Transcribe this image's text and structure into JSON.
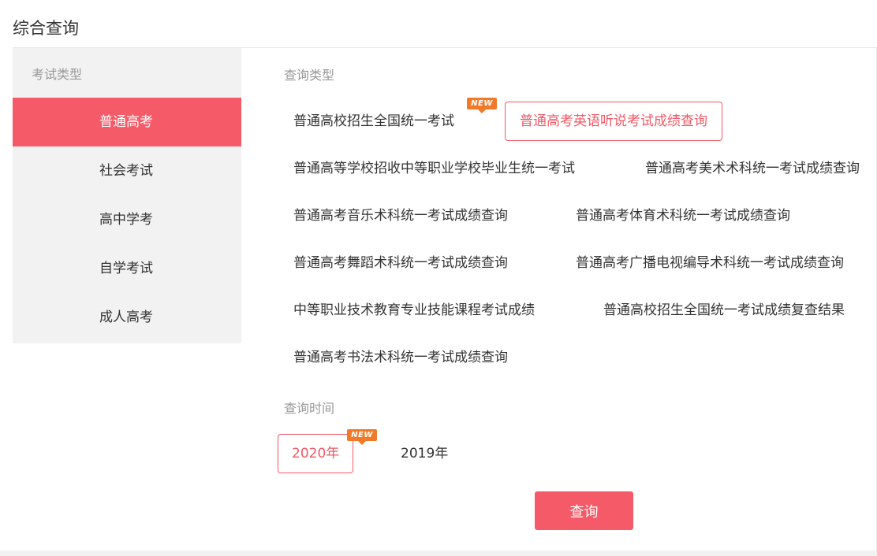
{
  "page": {
    "title": "综合查询"
  },
  "sidebar": {
    "heading": "考试类型",
    "items": [
      {
        "label": "普通高考",
        "active": true
      },
      {
        "label": "社会考试",
        "active": false
      },
      {
        "label": "高中学考",
        "active": false
      },
      {
        "label": "自学考试",
        "active": false
      },
      {
        "label": "成人高考",
        "active": false
      }
    ]
  },
  "query_type": {
    "label": "查询类型",
    "options": [
      {
        "label": "普通高校招生全国统一考试",
        "is_new": true,
        "selected": false
      },
      {
        "label": "普通高考英语听说考试成绩查询",
        "is_new": false,
        "selected": true
      },
      {
        "label": "普通高等学校招收中等职业学校毕业生统一考试",
        "is_new": false,
        "selected": false
      },
      {
        "label": "普通高考美术术科统一考试成绩查询",
        "is_new": false,
        "selected": false
      },
      {
        "label": "普通高考音乐术科统一考试成绩查询",
        "is_new": false,
        "selected": false
      },
      {
        "label": "普通高考体育术科统一考试成绩查询",
        "is_new": false,
        "selected": false
      },
      {
        "label": "普通高考舞蹈术科统一考试成绩查询",
        "is_new": false,
        "selected": false
      },
      {
        "label": "普通高考广播电视编导术科统一考试成绩查询",
        "is_new": false,
        "selected": false
      },
      {
        "label": "中等职业技术教育专业技能课程考试成绩",
        "is_new": false,
        "selected": false
      },
      {
        "label": "普通高校招生全国统一考试成绩复查结果",
        "is_new": false,
        "selected": false
      },
      {
        "label": "普通高考书法术科统一考试成绩查询",
        "is_new": false,
        "selected": false
      }
    ]
  },
  "query_time": {
    "label": "查询时间",
    "years": [
      {
        "label": "2020年",
        "is_new": true,
        "selected": true
      },
      {
        "label": "2019年",
        "is_new": false,
        "selected": false
      }
    ]
  },
  "badge": {
    "text": "NEW"
  },
  "actions": {
    "query_label": "查询"
  },
  "colors": {
    "accent": "#f45a67",
    "badge": "#f07a2a",
    "sidebar_bg": "#f2f2f2",
    "muted_text": "#999999"
  }
}
